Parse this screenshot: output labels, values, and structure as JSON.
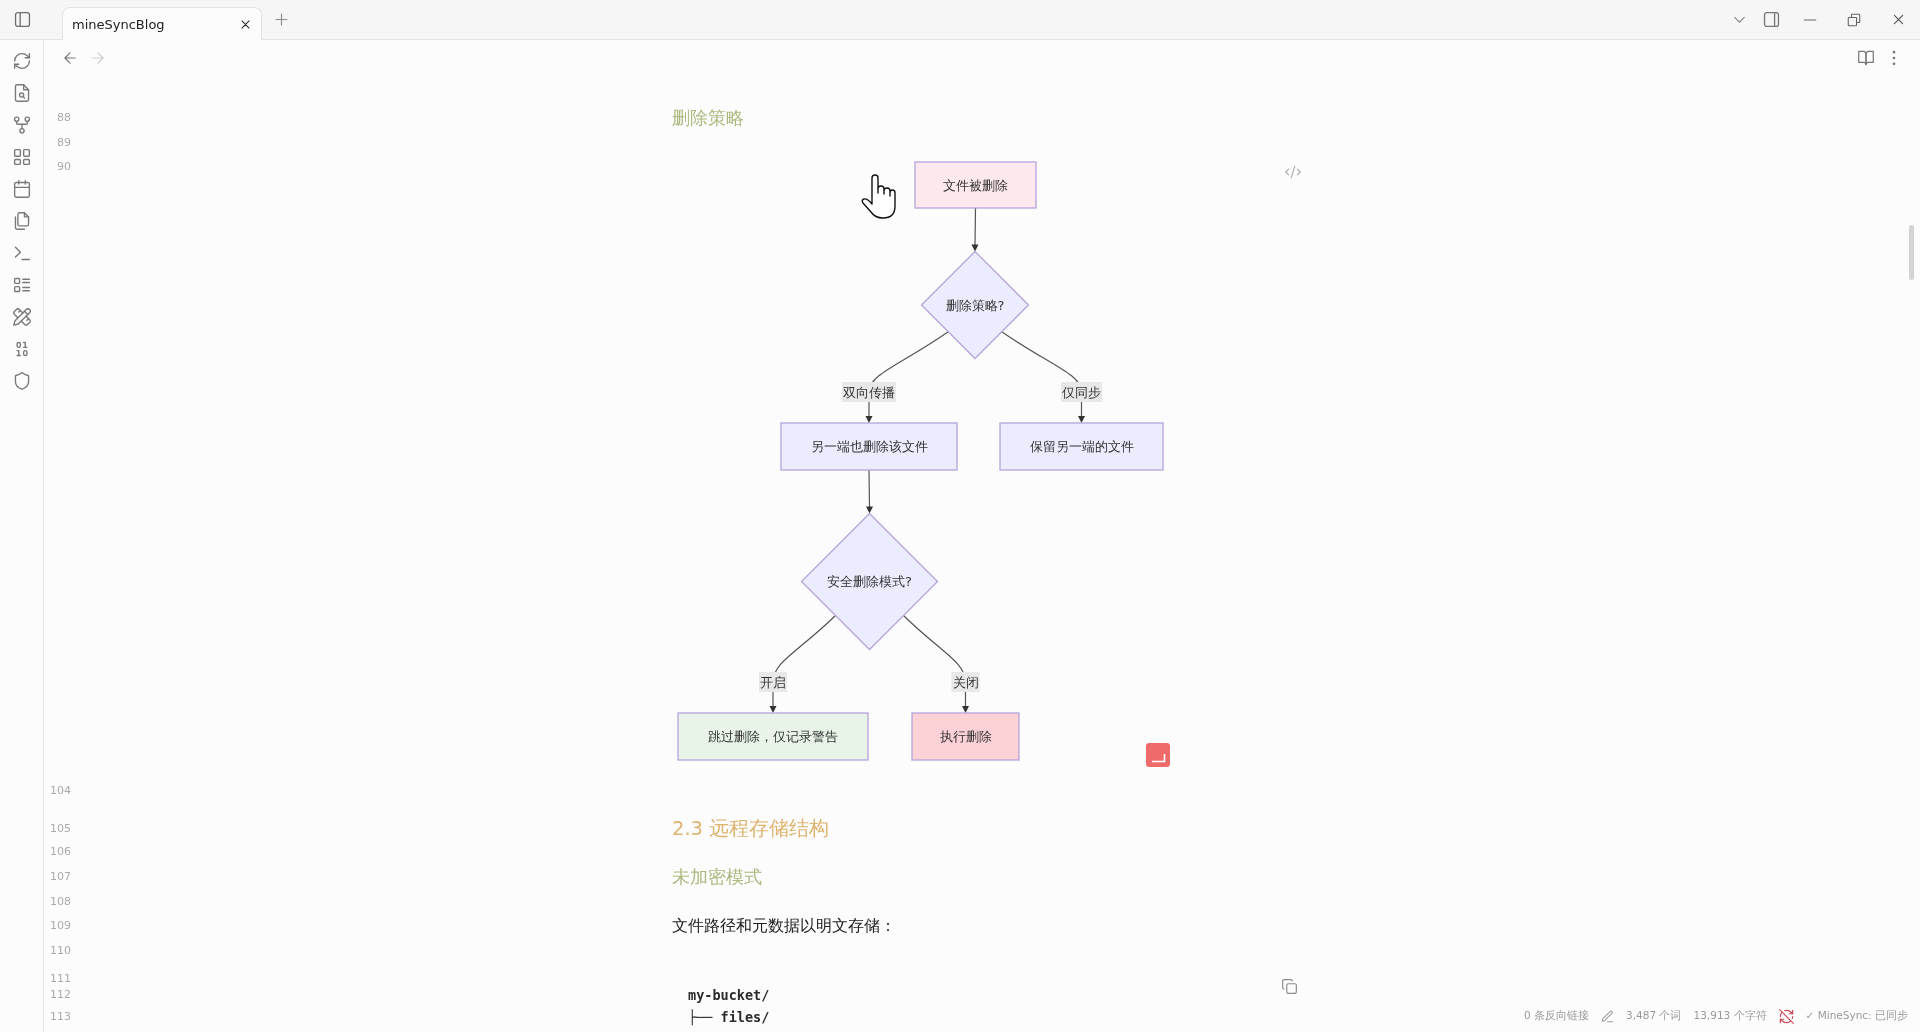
{
  "tab_bar": {
    "tabs": [
      {
        "label": "mineSyncBlog",
        "selected": true
      }
    ]
  },
  "navigation": [
    {
      "kind": "back",
      "disabled": false
    },
    {
      "kind": "forward",
      "disabled": true
    }
  ],
  "editor": {
    "lines": [
      {
        "number": "88",
        "kind": "h4",
        "text": "删除策略"
      },
      {
        "number": "89",
        "kind": "blank"
      },
      {
        "number": "90",
        "kind": "diagram",
        "flowchart": {
          "label": "文件被删除",
          "kind": "process",
          "color": "#fde9ed",
          "children": [
            {
              "label": "删除策略?",
              "kind": "decision",
              "color": "#ececff",
              "children": [
                {
                  "edge_label": "双向传播",
                  "label": "另一端也删除该文件",
                  "kind": "process",
                  "color": "#ececff",
                  "children": [
                    {
                      "label": "安全删除模式?",
                      "kind": "decision",
                      "color": "#ececff",
                      "children": [
                        {
                          "edge_label": "开启",
                          "label": "跳过删除，仅记录警告",
                          "kind": "process",
                          "color": "#e7f4e7"
                        },
                        {
                          "edge_label": "关闭",
                          "label": "执行删除",
                          "kind": "process",
                          "color": "#fdd2d7"
                        }
                      ]
                    }
                  ]
                },
                {
                  "edge_label": "仅同步",
                  "label": "保留另一端的文件",
                  "kind": "process",
                  "color": "#ececff"
                }
              ]
            }
          ]
        }
      },
      {
        "number": "104",
        "kind": "blank"
      },
      {
        "number": "105",
        "kind": "h3",
        "text": "2.3 远程存储结构"
      },
      {
        "number": "106",
        "kind": "blank"
      },
      {
        "number": "107",
        "kind": "h4",
        "text": "未加密模式"
      },
      {
        "number": "108",
        "kind": "blank"
      },
      {
        "number": "109",
        "kind": "paragraph",
        "text": "文件路径和元数据以明文存储："
      },
      {
        "number": "110",
        "kind": "blank"
      },
      {
        "number": "111",
        "kind": "code"
      },
      {
        "number": "112",
        "kind": "code",
        "text": "my-bucket/"
      },
      {
        "number": "113",
        "kind": "code",
        "text": "├── files/"
      }
    ]
  },
  "status_bar": {
    "backlinks": "0 条反向链接",
    "words": "3,487 个词",
    "characters": "13,913 个字符",
    "sync": "✓ MineSync: 已同步"
  }
}
